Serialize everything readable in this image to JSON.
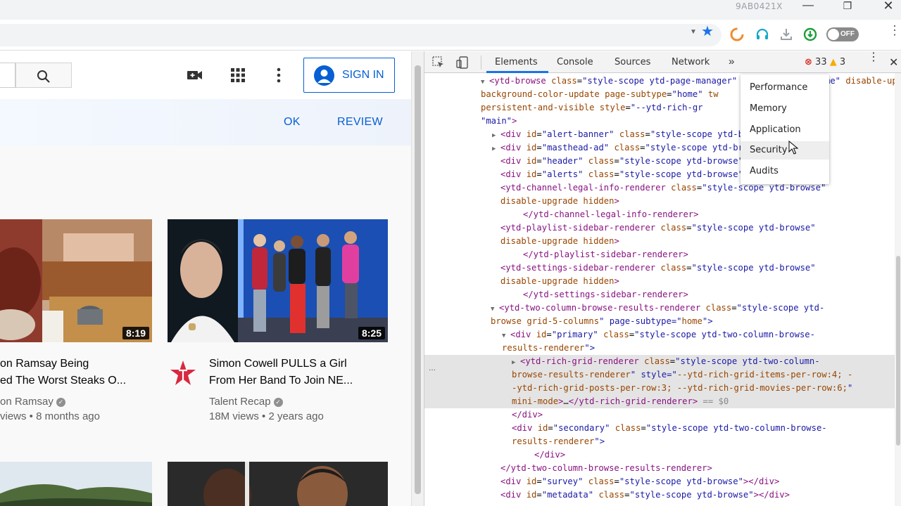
{
  "window": {
    "title": "9AB0421X",
    "minimize": "—",
    "maximize": "❐",
    "close": "✕"
  },
  "toolbar": {
    "dropdown_glyph": "▼",
    "star_glyph": "★",
    "extension_toggle_label": "OFF",
    "menu_glyph": "⋮"
  },
  "youtube": {
    "signin_label": "SIGN IN",
    "banner": {
      "ok_label": "OK",
      "review_label": "REVIEW"
    },
    "videos": [
      {
        "title_line1": "on Ramsay Being",
        "title_line2": "ed The Worst Steaks O...",
        "channel": "on Ramsay",
        "stats": "views • 8 months ago",
        "duration": "8:19"
      },
      {
        "title_line1": "Simon Cowell PULLS a Girl",
        "title_line2": "From Her Band To Join NE...",
        "channel": "Talent Recap",
        "stats": "18M views • 2 years ago",
        "duration": "8:25"
      }
    ],
    "verified_glyph": "✓"
  },
  "devtools": {
    "tabs": [
      "Elements",
      "Console",
      "Sources",
      "Network"
    ],
    "more_tabs_glyph": "»",
    "errors": "33",
    "warnings": "3",
    "error_glyph": "⊗",
    "warning_glyph": "▲",
    "kebab_glyph": "⋮",
    "close_glyph": "✕",
    "gutter_ellipsis": "...",
    "more_tabs_menu": [
      "Performance",
      "Memory",
      "Application",
      "Security",
      "Audits"
    ],
    "hovered_menu_item": "Security",
    "dom_lines": [
      "▼<ytd-browse class=\"style-scope ytd-page-manager\" page-subtype=\"home\" disable-upgrade hidden=\"\" mini-guide-visible=\"\" title_",
      "background-color-update page-subtype=\"home\" tw",
      "persistent-and-visible style=\"--ytd-rich-gr",
      "\"main\">",
      "▶<div id=\"alert-banner\" class=\"style-scope ytd-browse\">…</div>",
      "▶<div id=\"masthead-ad\" class=\"style-scope ytd-browse\">…</div>",
      "<div id=\"header\" class=\"style-scope ytd-browse\"></div>",
      "<div id=\"alerts\" class=\"style-scope ytd-browse\"></div>",
      "<ytd-channel-legal-info-renderer class=\"style-scope ytd-browse\"",
      "disable-upgrade hidden>",
      "</ytd-channel-legal-info-renderer>",
      "<ytd-playlist-sidebar-renderer class=\"style-scope ytd-browse\"",
      "disable-upgrade hidden>",
      "</ytd-playlist-sidebar-renderer>",
      "<ytd-settings-sidebar-renderer class=\"style-scope ytd-browse\"",
      "disable-upgrade hidden>",
      "</ytd-settings-sidebar-renderer>",
      "▼<ytd-two-column-browse-results-renderer class=\"style-scope ytd-",
      "browse grid-5-columns\" page-subtype=\"home\">",
      "▼<div id=\"primary\" class=\"style-scope ytd-two-column-browse-",
      "results-renderer\">",
      "▶<ytd-rich-grid-renderer class=\"style-scope ytd-two-column-",
      "browse-results-renderer\" style=\"--ytd-rich-grid-items-per-row:4; -",
      "-ytd-rich-grid-posts-per-row:3; --ytd-rich-grid-movies-per-row:6;\"",
      "mini-mode>…</ytd-rich-grid-renderer> == $0",
      "</div>",
      "<div id=\"secondary\" class=\"style-scope ytd-two-column-browse-",
      "results-renderer\">",
      "</div>",
      "</ytd-two-column-browse-results-renderer>",
      "<div id=\"survey\" class=\"style-scope ytd-browse\"></div>",
      "<div id=\"metadata\" class=\"style-scope ytd-browse\"></div>"
    ]
  },
  "colors": {
    "youtube_blue": "#065fd4",
    "devtools_tag": "#881280",
    "devtools_attr_name": "#994500",
    "devtools_attr_value": "#1a1aa6",
    "error_red": "#d93025"
  }
}
